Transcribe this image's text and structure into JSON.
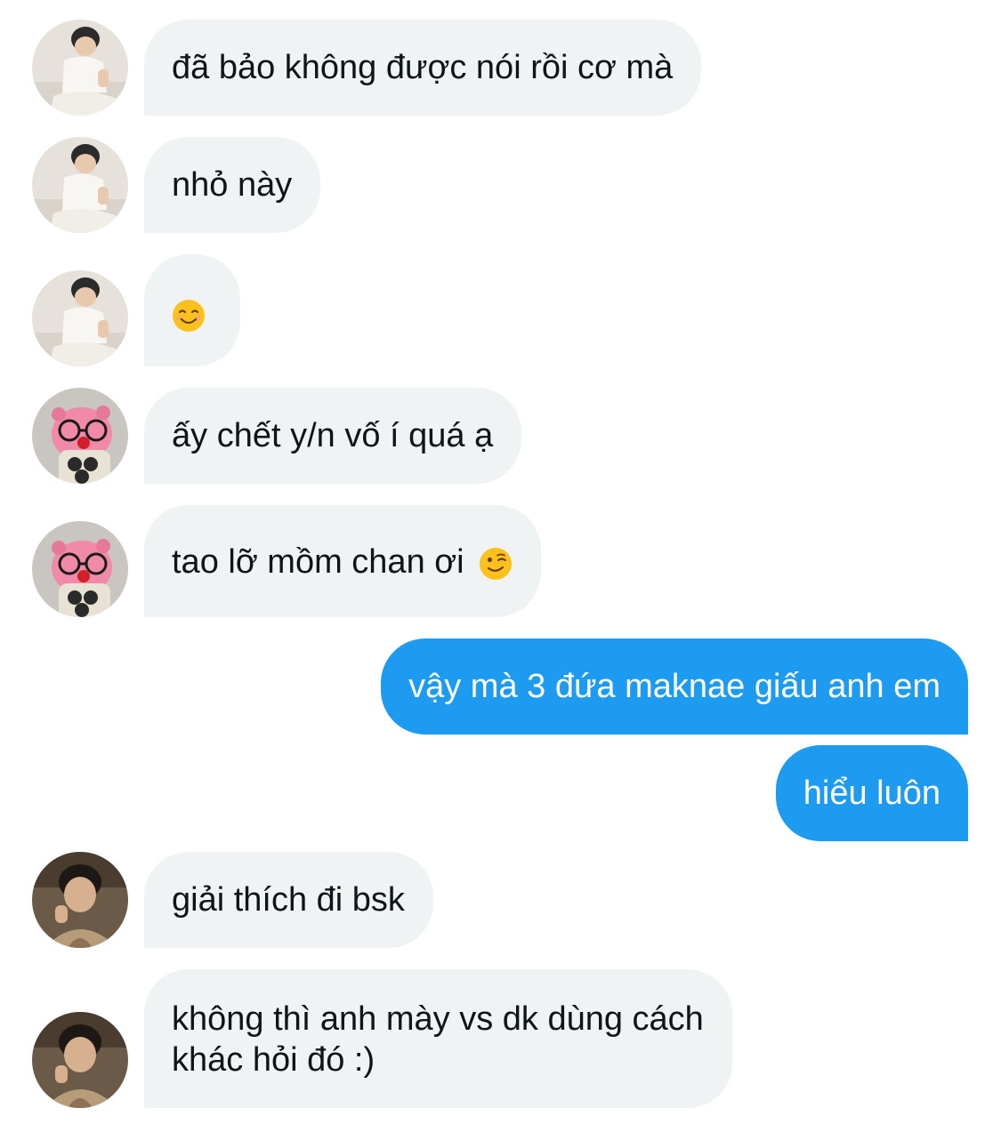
{
  "messages": [
    {
      "sender": "in",
      "avatar": "avatar-white-shirt",
      "text": "đã bảo không được nói rồi cơ mà"
    },
    {
      "sender": "in",
      "avatar": "avatar-white-shirt",
      "text": "nhỏ này"
    },
    {
      "sender": "in",
      "avatar": "avatar-white-shirt",
      "emoji": "smiling-face-emoji"
    },
    {
      "sender": "in",
      "avatar": "avatar-pink-plush",
      "text": "ấy chết y/n vố í quá ạ"
    },
    {
      "sender": "in",
      "avatar": "avatar-pink-plush",
      "text": "tao lỡ mồm chan ơi ",
      "emoji": "winking-face-emoji"
    },
    {
      "sender": "out",
      "text": "vậy mà 3 đứa maknae giấu anh em"
    },
    {
      "sender": "out",
      "text": "hiểu luôn"
    },
    {
      "sender": "in",
      "avatar": "avatar-dark-portrait",
      "text": "giải thích đi bsk"
    },
    {
      "sender": "in",
      "avatar": "avatar-dark-portrait",
      "text_line1": "không thì anh mày vs dk dùng cách",
      "text_line2": "khác hỏi đó :)"
    }
  ],
  "colors": {
    "incoming_bubble": "#eff3f4",
    "outgoing_bubble": "#1d9bf0",
    "incoming_text": "#0f1419",
    "outgoing_text": "#ffffff"
  }
}
